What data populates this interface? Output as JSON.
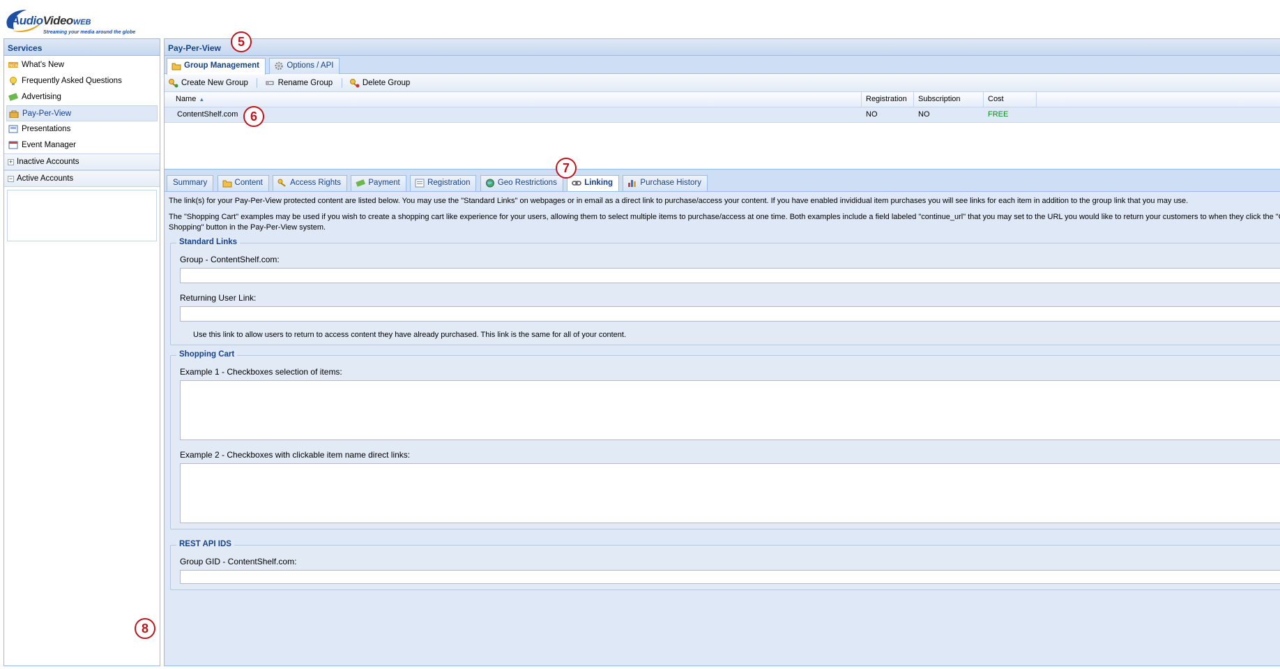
{
  "logo": {
    "brand_a": "Audio",
    "brand_b": "Video",
    "brand_c": "WEB",
    "tagline": "Streaming your media around the globe"
  },
  "sidebar": {
    "title": "Services",
    "items": [
      {
        "label": "What's New",
        "icon": "new-icon"
      },
      {
        "label": "Frequently Asked Questions",
        "icon": "lightbulb-icon"
      },
      {
        "label": "Advertising",
        "icon": "money-icon"
      },
      {
        "label": "Pay-Per-View",
        "icon": "ppv-icon",
        "selected": true
      },
      {
        "label": "Presentations",
        "icon": "presentation-icon"
      },
      {
        "label": "Event Manager",
        "icon": "calendar-icon"
      }
    ],
    "sections": [
      {
        "label": "Inactive Accounts",
        "state": "+"
      },
      {
        "label": "Active Accounts",
        "state": "−"
      }
    ]
  },
  "main": {
    "title": "Pay-Per-View",
    "top_tabs": [
      {
        "label": "Group Management",
        "active": true
      },
      {
        "label": "Options / API",
        "active": false
      }
    ],
    "toolbar": {
      "create": "Create New Group",
      "rename": "Rename Group",
      "delete": "Delete Group"
    },
    "grid": {
      "columns": [
        "Name",
        "Registration",
        "Subscription",
        "Cost"
      ],
      "rows": [
        {
          "name": "ContentShelf.com",
          "registration": "NO",
          "subscription": "NO",
          "cost": "FREE"
        }
      ]
    },
    "detail_tabs": [
      "Summary",
      "Content",
      "Access Rights",
      "Payment",
      "Registration",
      "Geo Restrictions",
      "Linking",
      "Purchase History"
    ],
    "active_detail_tab": "Linking",
    "intro_1": "The link(s) for your Pay-Per-View protected content are listed below. You may use the \"Standard Links\" on webpages or in email as a direct link to purchase/access your content. If you have enabled invididual item purchases you will see links for each item in addition to the group link that you may use.",
    "intro_2a": "The \"Shopping Cart\" examples may be used if you wish to create a shopping cart like experience for your users, allowing them to select multiple items to purchase/access at one time. Both examples include a field labeled \"continue_url\" that you may set to the URL you would like to return your customers to when they click the \"Cont",
    "intro_2b": "Shopping\" button in the Pay-Per-View system.",
    "standard_links": {
      "legend": "Standard Links",
      "group_label": "Group - ContentShelf.com:",
      "group_value": "",
      "returning_label": "Returning User Link:",
      "returning_value": "",
      "hint": "Use this link to allow users to return to access content they have already purchased. This link is the same for all of your content."
    },
    "shopping_cart": {
      "legend": "Shopping Cart",
      "example1_label": "Example 1 - Checkboxes selection of items:",
      "example2_label": "Example 2 - Checkboxes with clickable item name direct links:"
    },
    "rest_api": {
      "legend": "REST API IDS",
      "gid_label": "Group GID - ContentShelf.com:",
      "gid_value": ""
    }
  },
  "callouts": [
    "5",
    "6",
    "7",
    "8"
  ],
  "colors": {
    "header_text": "#15428b",
    "border": "#99bbe8",
    "free": "#0a8a1a",
    "callout": "#c0141b"
  }
}
